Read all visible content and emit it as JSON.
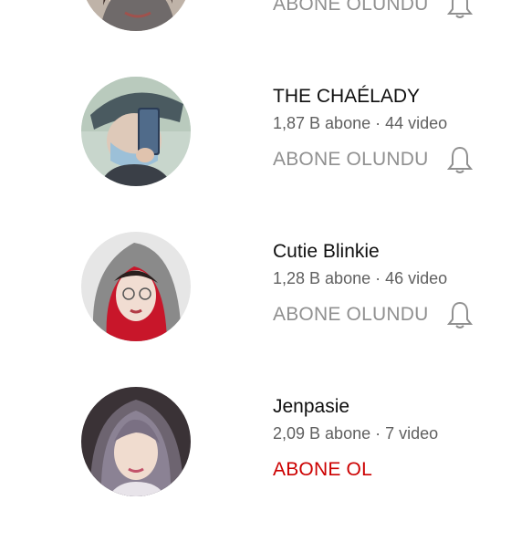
{
  "channels": [
    {
      "name": "",
      "meta": "",
      "button_label": "ABONE OLUNDU",
      "subscribed": true,
      "avatar_icon": "avatar-partial"
    },
    {
      "name": "THE CHAÉLADY",
      "meta": "1,87 B abone · 44 video",
      "button_label": "ABONE OLUNDU",
      "subscribed": true,
      "avatar_icon": "avatar-masked-selfie"
    },
    {
      "name": "Cutie Blinkie",
      "meta": "1,28 B abone · 46 video",
      "button_label": "ABONE OLUNDU",
      "subscribed": true,
      "avatar_icon": "avatar-red-hood"
    },
    {
      "name": "Jenpasie",
      "meta": "2,09 B abone · 7 video",
      "button_label": "ABONE OL",
      "subscribed": false,
      "avatar_icon": "avatar-portrait"
    }
  ],
  "colors": {
    "subscribed_text": "#909090",
    "subscribe_red": "#cc0000",
    "title_text": "#0f0f0f",
    "meta_text": "#606060"
  }
}
